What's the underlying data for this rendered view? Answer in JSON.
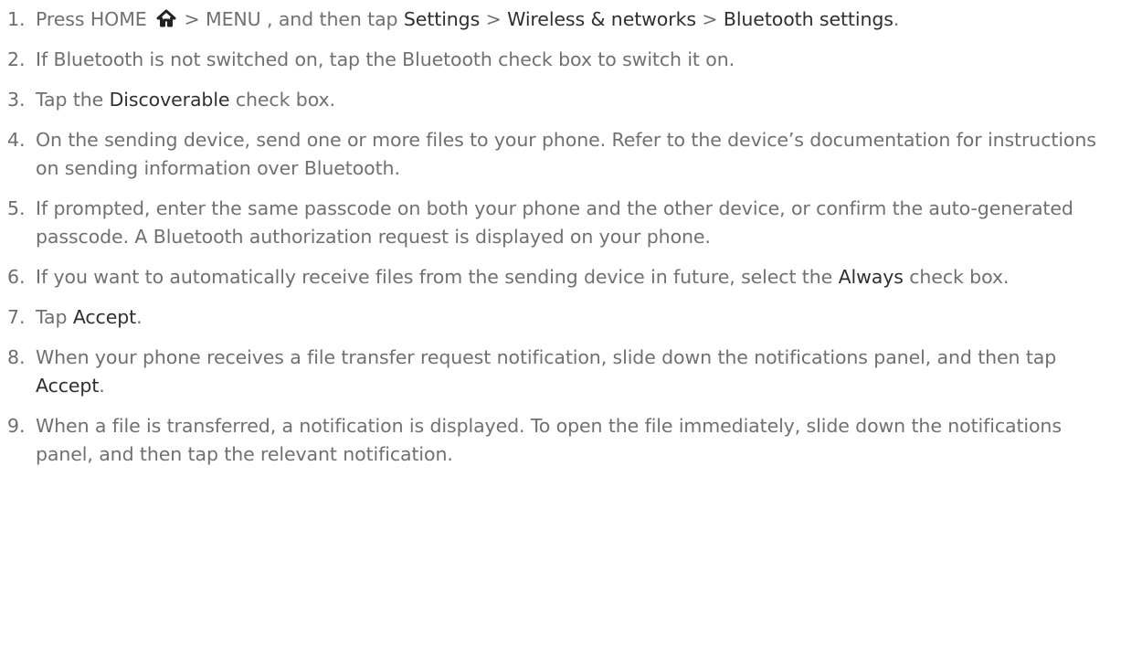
{
  "steps": [
    {
      "number": "1.",
      "parts": [
        {
          "t": "Press HOME "
        },
        {
          "icon": "home-icon"
        },
        {
          "t": " > MENU , and then tap "
        },
        {
          "t": "Settings",
          "kw": true
        },
        {
          "t": " > "
        },
        {
          "t": "Wireless & networks",
          "kw": true
        },
        {
          "t": " > "
        },
        {
          "t": "Bluetooth settings",
          "kw": true
        },
        {
          "t": "."
        }
      ]
    },
    {
      "number": "2.",
      "parts": [
        {
          "t": "If Bluetooth is not switched on, tap the Bluetooth check box to switch it on."
        }
      ]
    },
    {
      "number": "3.",
      "parts": [
        {
          "t": "Tap the "
        },
        {
          "t": "Discoverable",
          "kw": true
        },
        {
          "t": " check box."
        }
      ]
    },
    {
      "number": "4.",
      "parts": [
        {
          "t": "On the sending device, send one or more files to your phone. Refer to the device’s documentation for instructions on sending information over Bluetooth."
        }
      ]
    },
    {
      "number": "5.",
      "parts": [
        {
          "t": "If prompted, enter the same passcode on both your phone and the other device, or confirm the auto-generated passcode. A Bluetooth authorization request is displayed on your phone."
        }
      ]
    },
    {
      "number": "6.",
      "parts": [
        {
          "t": "If you want to automatically receive files from the sending device in future, select the "
        },
        {
          "t": "Always",
          "kw": true
        },
        {
          "t": " check box."
        }
      ]
    },
    {
      "number": "7.",
      "parts": [
        {
          "t": "Tap "
        },
        {
          "t": "Accept",
          "kw": true
        },
        {
          "t": "."
        }
      ]
    },
    {
      "number": "8.",
      "parts": [
        {
          "t": "When your phone receives a file transfer request notification, slide down the notifications panel, and then tap "
        },
        {
          "t": "Accept",
          "kw": true
        },
        {
          "t": "."
        }
      ]
    },
    {
      "number": "9.",
      "parts": [
        {
          "t": "When a file is transferred, a notification is displayed. To open the file immediately, slide down the notifications panel, and then tap the relevant notification."
        }
      ]
    }
  ]
}
